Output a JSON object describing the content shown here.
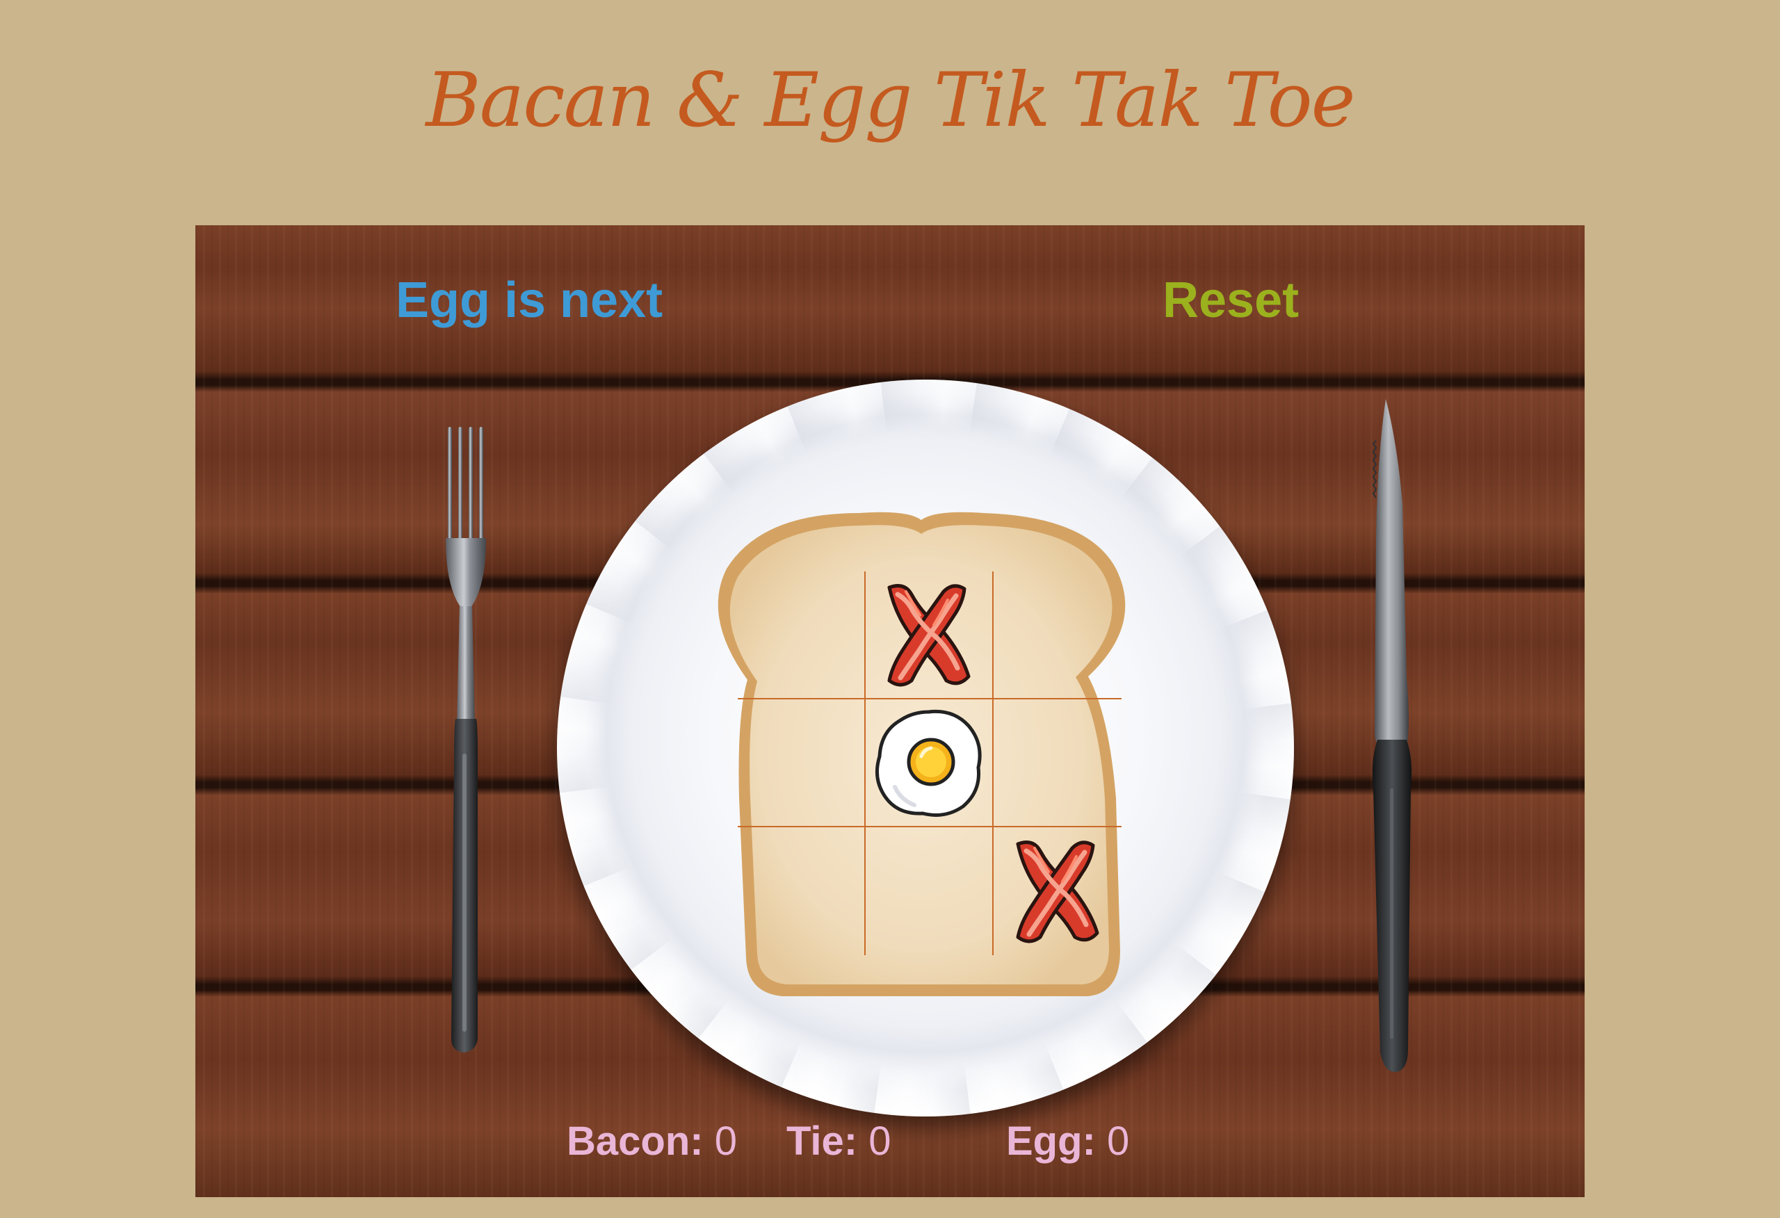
{
  "title": "Bacan & Egg Tik Tak Toe",
  "status": "Egg is next",
  "reset_label": "Reset",
  "board": [
    [
      "",
      "bacon",
      ""
    ],
    [
      "",
      "egg",
      ""
    ],
    [
      "",
      "",
      "bacon"
    ]
  ],
  "scores": {
    "bacon": {
      "label": "Bacon:",
      "value": "0"
    },
    "tie": {
      "label": "Tie:",
      "value": "0"
    },
    "egg": {
      "label": "Egg:",
      "value": "0"
    }
  },
  "icons": {
    "bacon": "bacon-icon",
    "egg": "fried-egg-icon",
    "fork": "fork-icon",
    "knife": "knife-icon",
    "plate": "plate-icon",
    "bread": "bread-slice-icon"
  },
  "colors": {
    "background": "#cbb58c",
    "title": "#c45a1f",
    "status": "#3e9bd6",
    "reset": "#9bb11d",
    "scores": "#eab6d7",
    "grid_lines": "#c96a28"
  }
}
